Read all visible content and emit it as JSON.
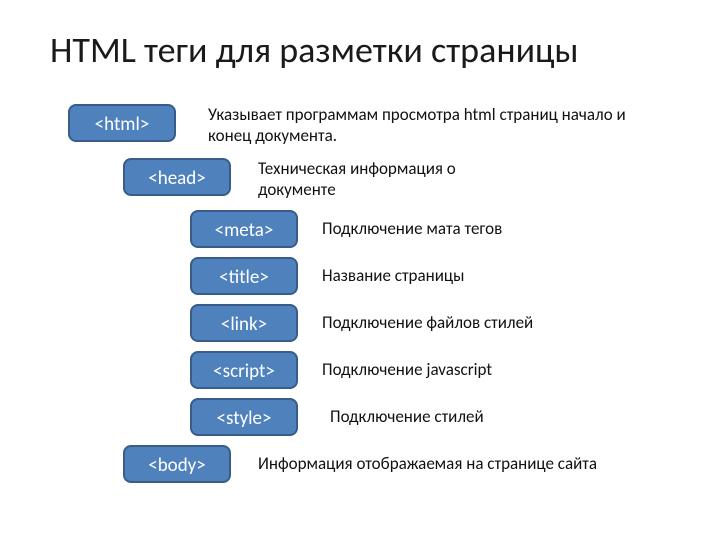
{
  "title": "HTML теги для разметки страницы",
  "rows": [
    {
      "tag": "<html>",
      "desc": "Указывает программам просмотра html страниц начало и конец документа."
    },
    {
      "tag": "<head>",
      "desc": "Техническая информация о документе"
    },
    {
      "tag": "<meta>",
      "desc": "Подключение мата тегов"
    },
    {
      "tag": "<title>",
      "desc": "Название страницы"
    },
    {
      "tag": "<link>",
      "desc": "Подключение файлов стилей"
    },
    {
      "tag": "<script>",
      "desc": "Подключение javascript"
    },
    {
      "tag": "<style>",
      "desc": "Подключение стилей"
    },
    {
      "tag": "<body>",
      "desc": "Информация отображаемая на странице сайта"
    }
  ]
}
